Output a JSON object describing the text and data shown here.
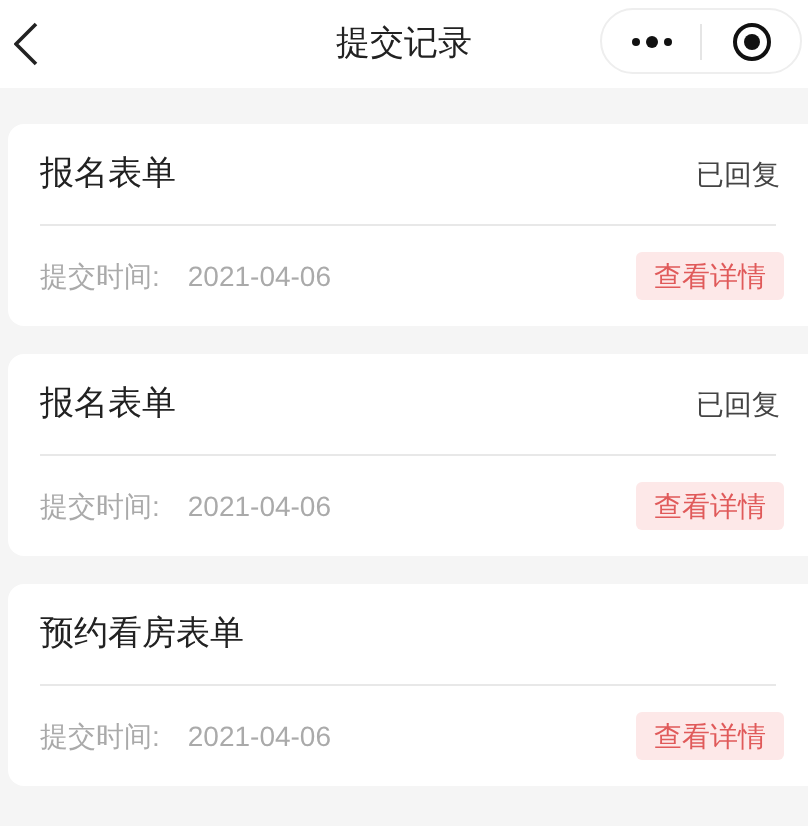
{
  "nav_bar": {
    "title": "提交记录"
  },
  "records": [
    {
      "title": "报名表单",
      "status": "已回复",
      "time_label": "提交时间:",
      "time": "2021-04-06",
      "action": "查看详情"
    },
    {
      "title": "报名表单",
      "status": "已回复",
      "time_label": "提交时间:",
      "time": "2021-04-06",
      "action": "查看详情"
    },
    {
      "title": "预约看房表单",
      "time_label": "提交时间:",
      "time": "2021-04-06",
      "action": "查看详情"
    }
  ]
}
